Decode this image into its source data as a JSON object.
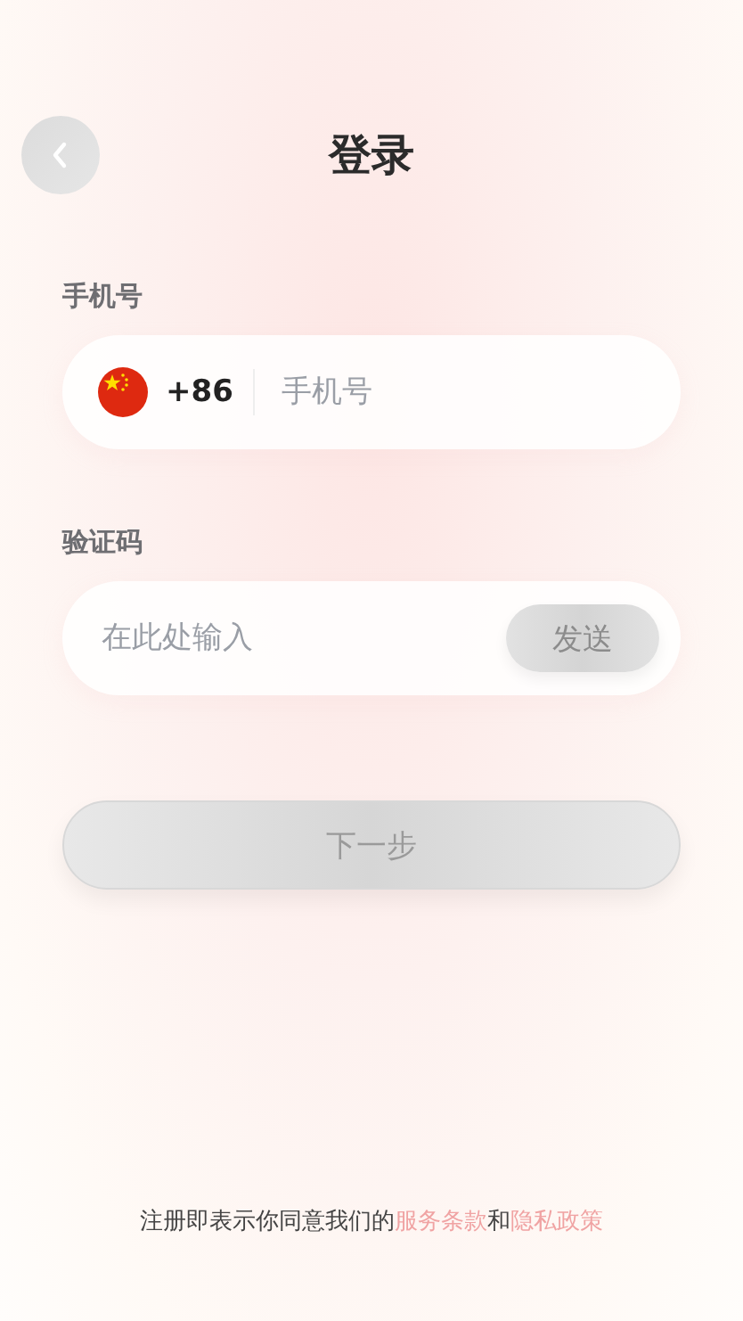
{
  "header": {
    "title": "登录"
  },
  "phone": {
    "label": "手机号",
    "country_code": "+86",
    "placeholder": "手机号"
  },
  "code": {
    "label": "验证码",
    "placeholder": "在此处输入",
    "send_button": "发送"
  },
  "next_button": {
    "label": "下一步",
    "disabled": true
  },
  "footer": {
    "text": "注册即表示你同意我们的",
    "links": [
      "服务条款",
      "隐私政策"
    ],
    "joiner": "和"
  }
}
